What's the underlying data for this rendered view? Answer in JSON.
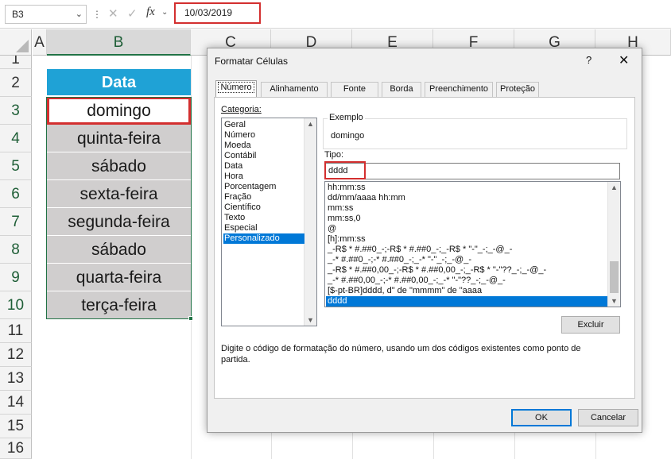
{
  "formula_bar": {
    "name_box": "B3",
    "cancel_symbol": "✕",
    "enter_symbol": "✓",
    "fx_label": "fx",
    "value": "10/03/2019"
  },
  "columns": [
    "A",
    "B",
    "C",
    "D",
    "E",
    "F",
    "G",
    "H"
  ],
  "rows": [
    "1",
    "2",
    "3",
    "4",
    "5",
    "6",
    "7",
    "8",
    "9",
    "10",
    "11",
    "12",
    "13",
    "14",
    "15",
    "16"
  ],
  "sheet": {
    "header": "Data",
    "cells": [
      "domingo",
      "quinta-feira",
      "sábado",
      "sexta-feira",
      "segunda-feira",
      "sábado",
      "quarta-feira",
      "terça-feira"
    ],
    "header_color": "#1fa2d6",
    "fill_color": "#d0cece",
    "highlight_color": "#d32f2f"
  },
  "dialog": {
    "title": "Formatar Células",
    "help": "?",
    "close": "✕",
    "tabs": [
      "Número",
      "Alinhamento",
      "Fonte",
      "Borda",
      "Preenchimento",
      "Proteção"
    ],
    "active_tab": "Número",
    "category_label": "Categoria:",
    "categories": [
      "Geral",
      "Número",
      "Moeda",
      "Contábil",
      "Data",
      "Hora",
      "Porcentagem",
      "Fração",
      "Científico",
      "Texto",
      "Especial",
      "Personalizado"
    ],
    "selected_category": "Personalizado",
    "example_label": "Exemplo",
    "example_value": "domingo",
    "type_label": "Tipo:",
    "type_value": "dddd",
    "formats": [
      "hh:mm:ss",
      "dd/mm/aaaa hh:mm",
      "mm:ss",
      "mm:ss,0",
      "@",
      "[h]:mm:ss",
      "_-R$ * #.##0_-;-R$ * #.##0_-;_-R$ * \"-\"_-;_-@_-",
      "_-* #.##0_-;-* #.##0_-;_-* \"-\"_-;_-@_-",
      "_-R$ * #.##0,00_-;-R$ * #.##0,00_-;_-R$ * \"-\"??_-;_-@_-",
      "_-* #.##0,00_-;-* #.##0,00_-;_-* \"-\"??_-;_-@_-",
      "[$-pt-BR]dddd, d\" de \"mmmm\" de \"aaaa",
      "dddd"
    ],
    "selected_format": "dddd",
    "delete_button": "Excluir",
    "description": "Digite o código de formatação do número, usando um dos códigos existentes como ponto de partida.",
    "ok_button": "OK",
    "cancel_button": "Cancelar",
    "accent_color": "#0078d7"
  }
}
